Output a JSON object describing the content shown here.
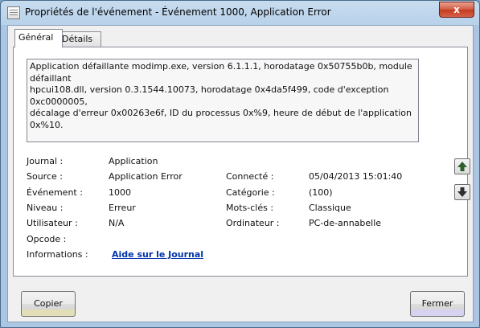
{
  "window": {
    "title": "Propriétés de l'événement - Événement 1000, Application Error",
    "close_label": "x"
  },
  "tabs": [
    {
      "label": "Général",
      "active": true
    },
    {
      "label": "Détails",
      "active": false
    }
  ],
  "description": "Application défaillante modimp.exe, version 6.1.1.1, horodatage 0x50755b0b, module défaillant\nhpcui108.dll, version 0.3.1544.10073, horodatage 0x4da5f499, code d'exception 0xc0000005,\ndécalage d'erreur 0x00263e6f, ID du processus 0x%9, heure de début de l'application 0x%10.",
  "fields": {
    "journal": {
      "label": "Journal :",
      "value": "Application"
    },
    "source": {
      "label": "Source :",
      "value": "Application Error"
    },
    "connecte": {
      "label": "Connecté :",
      "value": "05/04/2013 15:01:40"
    },
    "evenement": {
      "label": "Événement :",
      "value": "1000"
    },
    "categorie": {
      "label": "Catégorie :",
      "value": "(100)"
    },
    "niveau": {
      "label": "Niveau :",
      "value": "Erreur"
    },
    "mots_cles": {
      "label": "Mots-clés :",
      "value": "Classique"
    },
    "utilisateur": {
      "label": "Utilisateur :",
      "value": "N/A"
    },
    "ordinateur": {
      "label": "Ordinateur :",
      "value": "PC-de-annabelle"
    },
    "opcode": {
      "label": "Opcode :",
      "value": ""
    },
    "informations": {
      "label": "Informations :",
      "value": "Aide sur le Journal"
    }
  },
  "buttons": {
    "copy": "Copier",
    "close": "Fermer"
  },
  "icons": {
    "up": "arrow-up-icon",
    "down": "arrow-down-icon"
  }
}
